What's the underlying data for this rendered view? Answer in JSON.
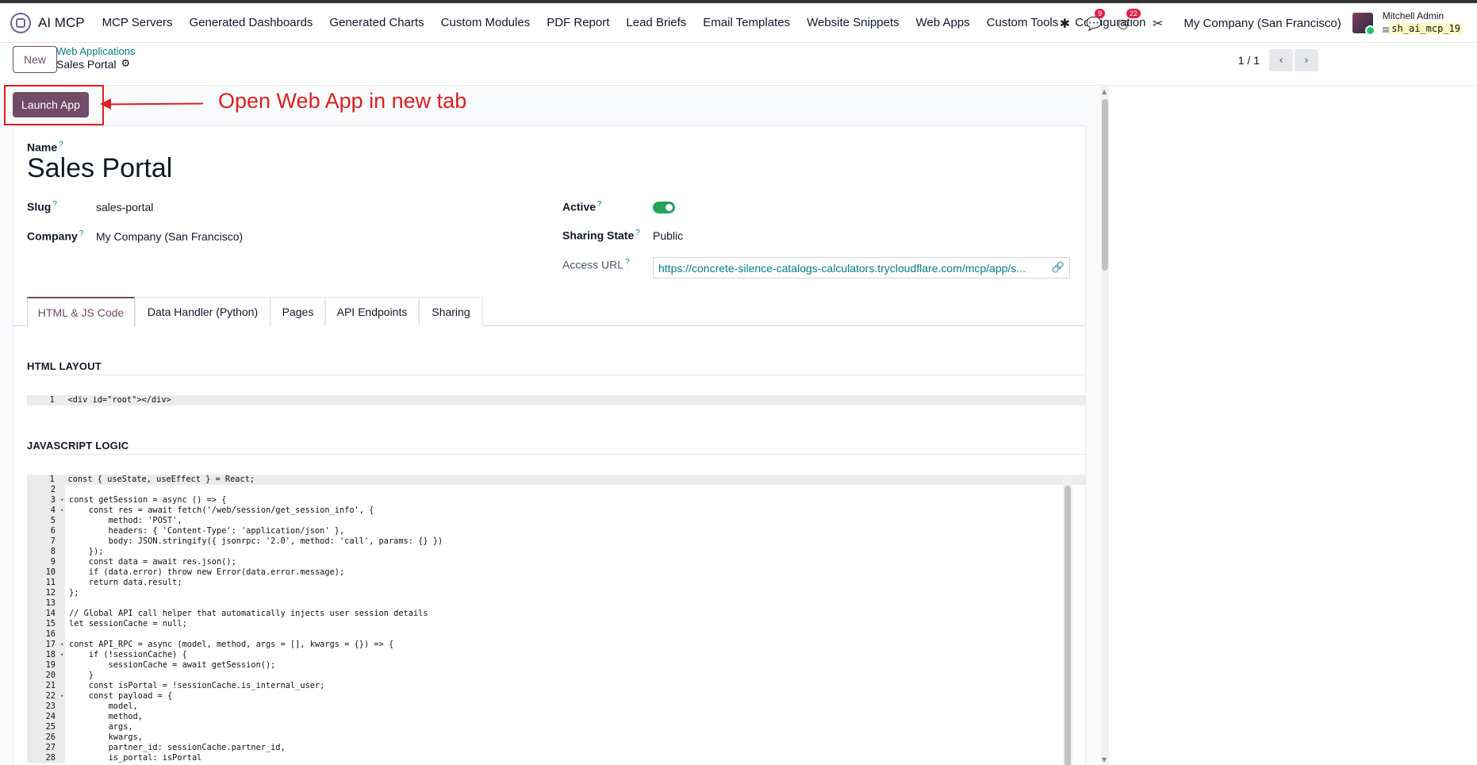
{
  "topbar": {
    "app_name": "AI MCP",
    "menu": [
      "MCP Servers",
      "Generated Dashboards",
      "Generated Charts",
      "Custom Modules",
      "PDF Report",
      "Lead Briefs",
      "Email Templates",
      "Website Snippets",
      "Web Apps",
      "Custom Tools",
      "Configuration"
    ],
    "messages_count": "9",
    "activities_count": "22",
    "company": "My Company (San Francisco)",
    "user_name": "Mitchell Admin",
    "database": "sh_ai_mcp_19"
  },
  "control": {
    "new_label": "New",
    "breadcrumb_parent": "Web Applications",
    "breadcrumb_current": "Sales Portal",
    "pager": "1 / 1"
  },
  "annotation": {
    "launch_label": "Launch App",
    "callout": "Open Web App in new tab"
  },
  "form": {
    "name_label": "Name",
    "name_value": "Sales Portal",
    "slug_label": "Slug",
    "slug_value": "sales-portal",
    "company_label": "Company",
    "company_value": "My Company (San Francisco)",
    "active_label": "Active",
    "active_value": true,
    "sharing_label": "Sharing State",
    "sharing_value": "Public",
    "url_label": "Access URL",
    "url_value": "https://concrete-silence-catalogs-calculators.trycloudflare.com/mcp/app/s..."
  },
  "tabs": [
    "HTML & JS Code",
    "Data Handler (Python)",
    "Pages",
    "API Endpoints",
    "Sharing"
  ],
  "html_section": {
    "title": "HTML LAYOUT",
    "lines": [
      {
        "n": "1",
        "text": "<div id=\"root\"></div>"
      }
    ]
  },
  "js_section": {
    "title": "JAVASCRIPT LOGIC",
    "lines": [
      {
        "n": "1",
        "fold": "",
        "text": "const { useState, useEffect } = React;"
      },
      {
        "n": "2",
        "fold": "",
        "text": ""
      },
      {
        "n": "3",
        "fold": "▾",
        "text": "const getSession = async () => {"
      },
      {
        "n": "4",
        "fold": "▾",
        "text": "    const res = await fetch('/web/session/get_session_info', {"
      },
      {
        "n": "5",
        "fold": "",
        "text": "        method: 'POST',"
      },
      {
        "n": "6",
        "fold": "",
        "text": "        headers: { 'Content-Type': 'application/json' },"
      },
      {
        "n": "7",
        "fold": "",
        "text": "        body: JSON.stringify({ jsonrpc: '2.0', method: 'call', params: {} })"
      },
      {
        "n": "8",
        "fold": "",
        "text": "    });"
      },
      {
        "n": "9",
        "fold": "",
        "text": "    const data = await res.json();"
      },
      {
        "n": "10",
        "fold": "",
        "text": "    if (data.error) throw new Error(data.error.message);"
      },
      {
        "n": "11",
        "fold": "",
        "text": "    return data.result;"
      },
      {
        "n": "12",
        "fold": "",
        "text": "};"
      },
      {
        "n": "13",
        "fold": "",
        "text": ""
      },
      {
        "n": "14",
        "fold": "",
        "text": "// Global API call helper that automatically injects user session details"
      },
      {
        "n": "15",
        "fold": "",
        "text": "let sessionCache = null;"
      },
      {
        "n": "16",
        "fold": "",
        "text": ""
      },
      {
        "n": "17",
        "fold": "▾",
        "text": "const API_RPC = async (model, method, args = [], kwargs = {}) => {"
      },
      {
        "n": "18",
        "fold": "▾",
        "text": "    if (!sessionCache) {"
      },
      {
        "n": "19",
        "fold": "",
        "text": "        sessionCache = await getSession();"
      },
      {
        "n": "20",
        "fold": "",
        "text": "    }"
      },
      {
        "n": "21",
        "fold": "",
        "text": "    const isPortal = !sessionCache.is_internal_user;"
      },
      {
        "n": "22",
        "fold": "▾",
        "text": "    const payload = {"
      },
      {
        "n": "23",
        "fold": "",
        "text": "        model,"
      },
      {
        "n": "24",
        "fold": "",
        "text": "        method,"
      },
      {
        "n": "25",
        "fold": "",
        "text": "        args,"
      },
      {
        "n": "26",
        "fold": "",
        "text": "        kwargs,"
      },
      {
        "n": "27",
        "fold": "",
        "text": "        partner_id: sessionCache.partner_id,"
      },
      {
        "n": "28",
        "fold": "",
        "text": "        is_portal: isPortal"
      }
    ]
  }
}
